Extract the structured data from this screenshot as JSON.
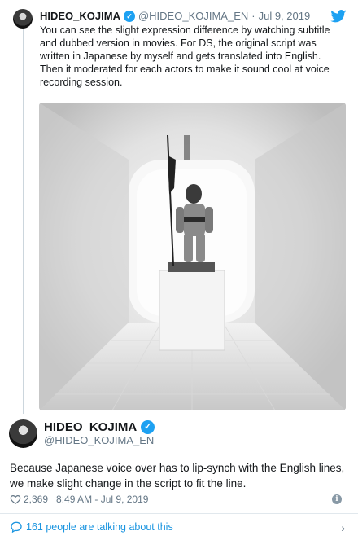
{
  "parent_tweet": {
    "name": "HIDEO_KOJIMA",
    "handle": "@HIDEO_KOJIMA_EN",
    "separator": "·",
    "date": "Jul 9, 2019",
    "text": "You can see the slight expression difference by watching subtitle and dubbed version in movies. For DS, the original script was written in Japanese by myself and gets translated into English. Then it moderated for each actors to make it sound cool at voice recording session."
  },
  "main_tweet": {
    "name": "HIDEO_KOJIMA",
    "handle": "@HIDEO_KOJIMA_EN",
    "text": "Because Japanese voice over has to lip-synch with the English lines, we make slight change in the script to fit the line.",
    "likes": "2,369",
    "timestamp": "8:49 AM - Jul 9, 2019"
  },
  "footer": {
    "talking": "161 people are talking about this"
  },
  "icons": {
    "verified": "verified-badge-icon",
    "bird": "twitter-bird-icon",
    "heart": "heart-icon",
    "info": "info-icon",
    "bubble": "speech-bubble-icon",
    "chevron": "chevron-right-icon"
  },
  "colors": {
    "accent": "#1da1f2",
    "link": "#1b95e0",
    "muted": "#657786",
    "divider": "#e1e8ed"
  }
}
